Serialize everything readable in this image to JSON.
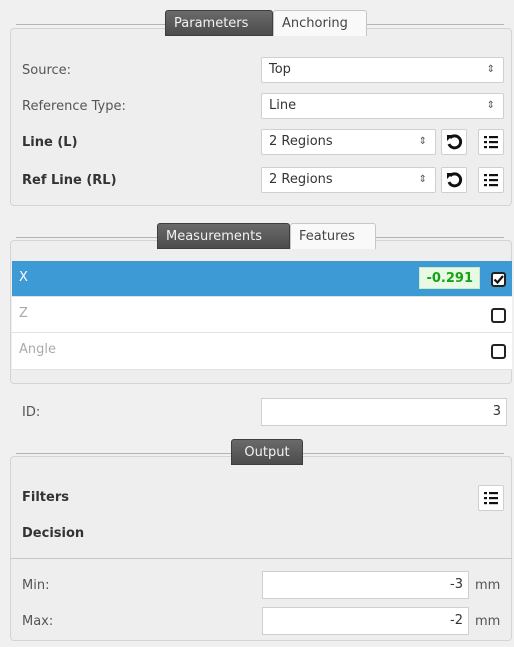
{
  "parameters_section": {
    "tabs": [
      "Parameters",
      "Anchoring"
    ],
    "fields": [
      {
        "label": "Source:",
        "value": "Top"
      },
      {
        "label": "Reference Type:",
        "value": "Line"
      },
      {
        "label": "Line (L)",
        "value": "2 Regions"
      },
      {
        "label": "Ref Line (RL)",
        "value": "2 Regions"
      }
    ]
  },
  "measurements_section": {
    "tabs": [
      "Measurements",
      "Features"
    ],
    "rows": [
      {
        "name": "X",
        "value": "-0.291",
        "checked": true,
        "selected": true
      },
      {
        "name": "Z",
        "checked": false
      },
      {
        "name": "Angle",
        "checked": false
      }
    ]
  },
  "id_field": {
    "label": "ID:",
    "value": "3"
  },
  "output_section": {
    "tab": "Output",
    "filters_label": "Filters",
    "decision_label": "Decision",
    "min": {
      "label": "Min:",
      "value": "-3",
      "unit": "mm"
    },
    "max": {
      "label": "Max:",
      "value": "-2",
      "unit": "mm"
    }
  },
  "colors": {
    "accent": "#3d9ad4",
    "value_green": "#16a313",
    "tab_active": "#555555"
  }
}
